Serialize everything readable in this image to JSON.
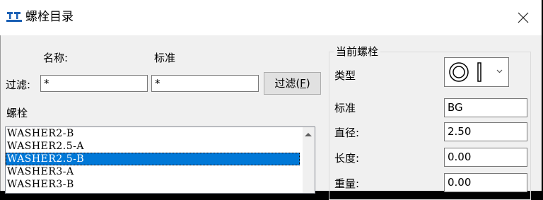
{
  "window": {
    "title": "螺栓目录",
    "icon": "bolt-app-icon",
    "close_icon": "close-icon"
  },
  "filter": {
    "name_header": "名称:",
    "standard_header": "标准",
    "label": "过滤:",
    "name_value": "*",
    "standard_value": "*",
    "button_label": "过滤(",
    "button_mnemonic": "F",
    "button_suffix": ")"
  },
  "bolts": {
    "label": "螺栓",
    "items": [
      "WASHER2-B",
      "WASHER2.5-A",
      "WASHER2.5-B",
      "WASHER3-A",
      "WASHER3-B"
    ],
    "selected_index": 2
  },
  "current": {
    "legend": "当前螺栓",
    "type_label": "类型",
    "type_icon": "washer-profile-icon",
    "standard_label": "标准",
    "standard_value": "BG",
    "diameter_label": "直径:",
    "diameter_value": "2.50",
    "length_label": "长度:",
    "length_value": "0.00",
    "weight_label": "重量:",
    "weight_value": "0.00"
  }
}
